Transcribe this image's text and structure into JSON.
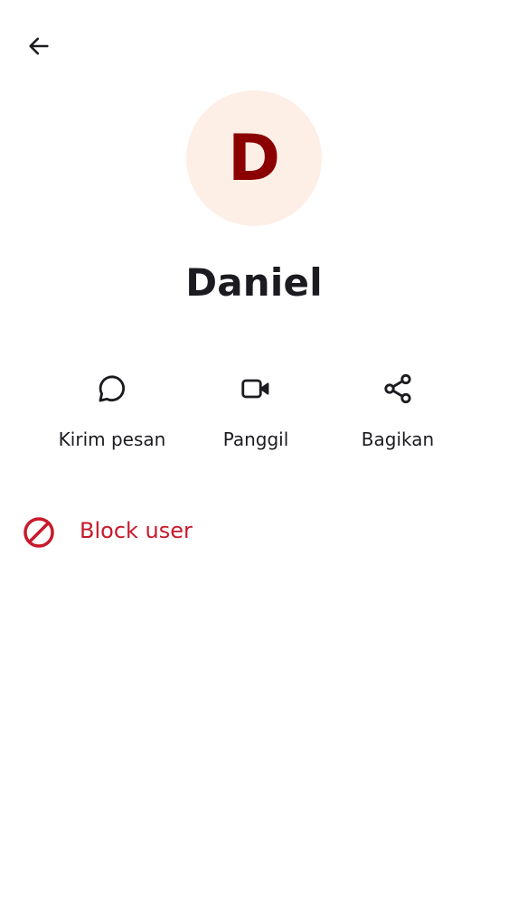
{
  "colors": {
    "avatar_bg": "#fdeee6",
    "avatar_letter": "#8b0000",
    "text_primary": "#1c1b20",
    "danger": "#c8192b"
  },
  "header": {
    "back_icon": "arrow-left-icon"
  },
  "contact": {
    "initial": "D",
    "name": "Daniel"
  },
  "actions": [
    {
      "label": "Kirim pesan",
      "icon": "chat-bubble-icon"
    },
    {
      "label": "Panggil",
      "icon": "video-camera-icon"
    },
    {
      "label": "Bagikan",
      "icon": "share-icon"
    }
  ],
  "block": {
    "label": "Block user",
    "icon": "block-icon"
  }
}
